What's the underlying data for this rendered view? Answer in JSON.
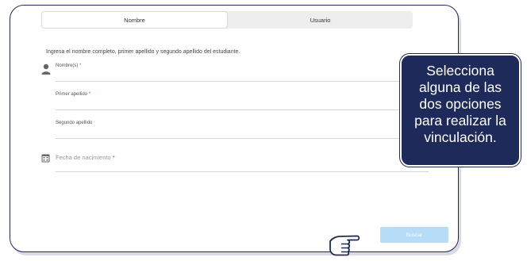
{
  "tabs": [
    "Nombre",
    "Usuario"
  ],
  "active_tab": "Nombre",
  "instruction": "Ingresa el nombre completo, primer apellido y segundo apellido del estudiante.",
  "fields": {
    "nombres": {
      "label": "Nombre(s)",
      "required": "*"
    },
    "primer_apellido": {
      "label": "Primer apellido",
      "required": "*"
    },
    "segundo_apellido": {
      "label": "Segundo apellido"
    },
    "fecha_nacimiento": {
      "label": "Fecha de nacimiento",
      "required": "*"
    }
  },
  "search_button": "Buscar",
  "tooltip": "Selecciona\nalguna de las\ndos opciones\npara realizar la\nvinculación.",
  "colors": {
    "frame_border": "#1e2a5a",
    "tooltip_bg": "#1e2a5a",
    "button_bg": "#b6dcf7",
    "required": "#e53935"
  },
  "icons": [
    "person-icon",
    "calendar-icon",
    "pointing-hand-icon"
  ]
}
